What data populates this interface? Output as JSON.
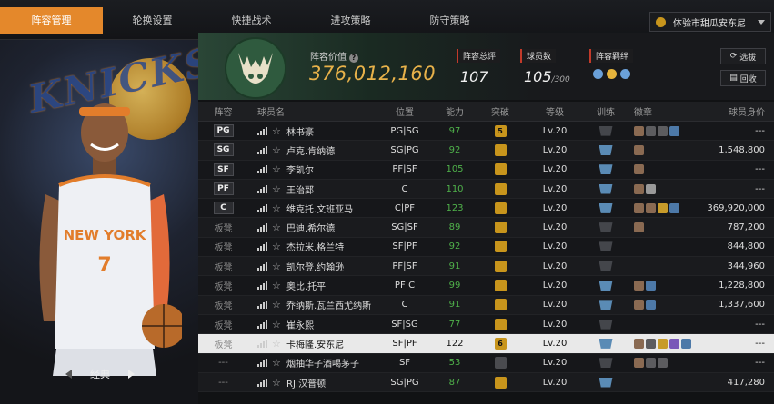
{
  "tabs": [
    {
      "label": "阵容管理",
      "active": true
    },
    {
      "label": "轮换设置"
    },
    {
      "label": "快捷战术"
    },
    {
      "label": "进攻策略"
    },
    {
      "label": "防守策略"
    }
  ],
  "team_select": {
    "label": "体验市甜瓜安东尼"
  },
  "left_panel": {
    "class_label": "经典",
    "team_text": "KNICKS",
    "jersey_team": "NEW YORK",
    "jersey_number": "7"
  },
  "info": {
    "value_label": "阵容价值",
    "value": "376,012,160",
    "rating_label": "阵容总评",
    "rating": "107",
    "count_label": "球员数",
    "count": "105",
    "count_max": "/300",
    "chem_label": "阵容羁绊",
    "btn_select": "选拔",
    "btn_recycle": "回收"
  },
  "table": {
    "headers": [
      "阵容",
      "球员名",
      "位置",
      "能力",
      "突破",
      "等级",
      "训练",
      "徽章",
      "球员身价"
    ],
    "rows": [
      {
        "slot": "PG",
        "name": "林书豪",
        "pos": "PG|SG",
        "ability": "97",
        "brk": "5",
        "level": "Lv.20",
        "price": "---"
      },
      {
        "slot": "SG",
        "name": "卢克.肯纳德",
        "pos": "SG|PG",
        "ability": "92",
        "brk": "",
        "level": "Lv.20",
        "price": "1,548,800"
      },
      {
        "slot": "SF",
        "name": "李凯尔",
        "pos": "PF|SF",
        "ability": "105",
        "brk": "",
        "level": "Lv.20",
        "price": "---"
      },
      {
        "slot": "PF",
        "name": "王治郅",
        "pos": "C",
        "ability": "110",
        "brk": "",
        "level": "Lv.20",
        "price": "---"
      },
      {
        "slot": "C",
        "name": "维克托.文班亚马",
        "pos": "C|PF",
        "ability": "123",
        "brk": "",
        "level": "Lv.20",
        "price": "369,920,000"
      },
      {
        "slot": "板凳",
        "name": "巴迪.希尔德",
        "pos": "SG|SF",
        "ability": "89",
        "brk": "",
        "level": "Lv.20",
        "price": "787,200"
      },
      {
        "slot": "板凳",
        "name": "杰拉米.格兰特",
        "pos": "SF|PF",
        "ability": "92",
        "brk": "",
        "level": "Lv.20",
        "price": "844,800"
      },
      {
        "slot": "板凳",
        "name": "凯尔登.约翰逊",
        "pos": "PF|SF",
        "ability": "91",
        "brk": "",
        "level": "Lv.20",
        "price": "344,960"
      },
      {
        "slot": "板凳",
        "name": "奥比.托平",
        "pos": "PF|C",
        "ability": "99",
        "brk": "",
        "level": "Lv.20",
        "price": "1,228,800"
      },
      {
        "slot": "板凳",
        "name": "乔纳斯.瓦兰西尤纳斯",
        "pos": "C",
        "ability": "91",
        "brk": "",
        "level": "Lv.20",
        "price": "1,337,600"
      },
      {
        "slot": "板凳",
        "name": "崔永熙",
        "pos": "SF|SG",
        "ability": "77",
        "brk": "",
        "level": "Lv.20",
        "price": "---"
      },
      {
        "slot": "板凳",
        "name": "卡梅隆.安东尼",
        "pos": "SF|PF",
        "ability": "122",
        "brk": "6",
        "level": "Lv.20",
        "price": "---",
        "selected": true
      },
      {
        "slot": "---",
        "name": "烟抽华子酒喝茅子",
        "pos": "SF",
        "ability": "53",
        "brk": "",
        "level": "Lv.20",
        "price": "---"
      },
      {
        "slot": "---",
        "name": "RJ.汉普顿",
        "pos": "SG|PG",
        "ability": "87",
        "brk": "",
        "level": "Lv.20",
        "price": "417,280"
      }
    ]
  }
}
